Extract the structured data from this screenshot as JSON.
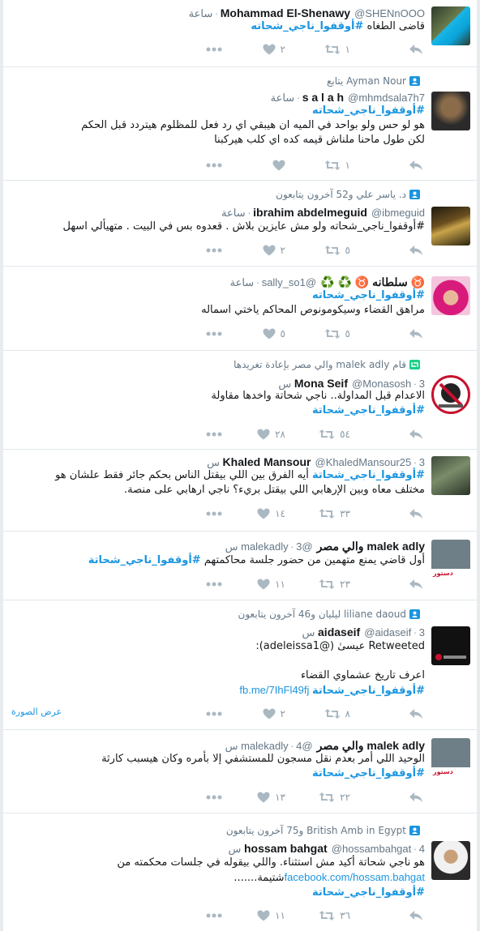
{
  "tweets": [
    {
      "name": "Mohammad El-Shenawy",
      "handle": "@SHENnOOO",
      "time": "ساعة",
      "lines": [
        "قاضى الطغاه #أوقفوا_ناجي_شحاته"
      ],
      "retweets": "١",
      "likes": "٢"
    },
    {
      "context": "Ayman Nour يتابع",
      "name": "s a l a h",
      "handle": "@mhmdsala7h7",
      "time": "ساعة",
      "lines": [
        "#أوقفوا_ناجي_شحاته",
        "هو لو حس ولو بواحد في الميه ان هيبقي اي رد فعل للمظلوم هيتردد قبل الحكم",
        "لكن طول ماحنا ملناش قيمه كده اي كلب  هيركبنا"
      ],
      "retweets": "١",
      "likes": ""
    },
    {
      "context": "د. ياسر علي و52 آخرون يتابعون",
      "name": "ibrahim abdelmeguid",
      "handle": "@ibmeguid",
      "time": "ساعة",
      "lines": [
        "#أوقفوا_ناجي_شحاته ولو مش عايزين بلاش . قعدوه بس في البيت . متهيألي اسهل"
      ],
      "retweets": "٥",
      "likes": "٢"
    },
    {
      "name": "♉ سلطانه ♉ ♻️ ♻️",
      "handle": "@sally_so1",
      "time": "ساعة",
      "lines": [
        "#أوقفوا_ناجي_شحاته",
        "مراهق القضاء وسيكومونوص المحاكم ياختي اسماله"
      ],
      "retweets": "٥",
      "likes": "٥"
    },
    {
      "context": "قام malek adly والي مصر بإعادة تغريدها",
      "name": "Mona Seif",
      "handle": "@Monasosh",
      "time": "3 س",
      "lines": [
        "الاعدام قبل المداولة.. ناجي شحاتة واخدها مقاولة",
        "#أوقفوا_ناجي_شحاتة"
      ],
      "retweets": "٥٤",
      "likes": "٢٨"
    },
    {
      "name": "Khaled Mansour",
      "handle": "@KhaledMansour25",
      "time": "3 س",
      "lines": [
        "#أوقفوا_ناجي_شحاتة أيه الفرق بين اللي بيقتل الناس بحكم جائر فقط علشان هو",
        "مختلف معاه وبين الإرهابي اللي بيقتل بريء؟ ناجي ارهابي على منصة."
      ],
      "retweets": "٣٣",
      "likes": "١٤"
    },
    {
      "name": "malek adly والي مصر",
      "handle": "@malekadly",
      "time": "3 س",
      "lines": [
        "أول قاضي يمنع متهمين من حضور جلسة محاكمتهم #أوقفوا_ناجي_شحاتة"
      ],
      "retweets": "٢٣",
      "likes": "١١"
    },
    {
      "context": "liliane daoud ليليان و46 آخرون يتابعون",
      "name": "aidaseif",
      "handle": "@aidaseif",
      "time": "3 س",
      "lines": [
        "Retweeted عيسىٰ (@adeleissa1):",
        "",
        "اعرف تاريخ عشماوي القضاء",
        "fb.me/7IhFl49fj  #أوقفوا_ناجي_شحاتة"
      ],
      "retweets": "٨",
      "likes": "٢",
      "view_photo": "عرض الصورة"
    },
    {
      "name": "malek adly والي مصر",
      "handle": "@malekadly",
      "time": "4 س",
      "lines": [
        "الوحيد اللي أمر بعدم نقل مسجون للمستشفي إلا بأمره وكان هيسبب كارثة",
        "#أوقفوا_ناجي_شحاتة"
      ],
      "retweets": "٢٢",
      "likes": "١٣"
    },
    {
      "context": "British Amb in Egypt و75 آخرون يتابعون",
      "name": "hossam bahgat",
      "handle": "@hossambahgat",
      "time": "4 س",
      "lines": [
        "هو ناجي شحاتة أكيد مش استثناء. واللي بيقوله في جلسات محكمته من",
        "شتيمة.......facebook.com/hossam.bahgat",
        "#أوقفوا_ناجي_شحاتة"
      ],
      "retweets": "٣٦",
      "likes": "١١"
    }
  ],
  "icons": {
    "reply": "reply-icon",
    "retweet": "retweet-icon",
    "like": "heart-icon",
    "more": "more-icon"
  },
  "colors": {
    "hashtag": "#1b95e0",
    "muted": "#aab8c2",
    "text": "#14171a"
  }
}
